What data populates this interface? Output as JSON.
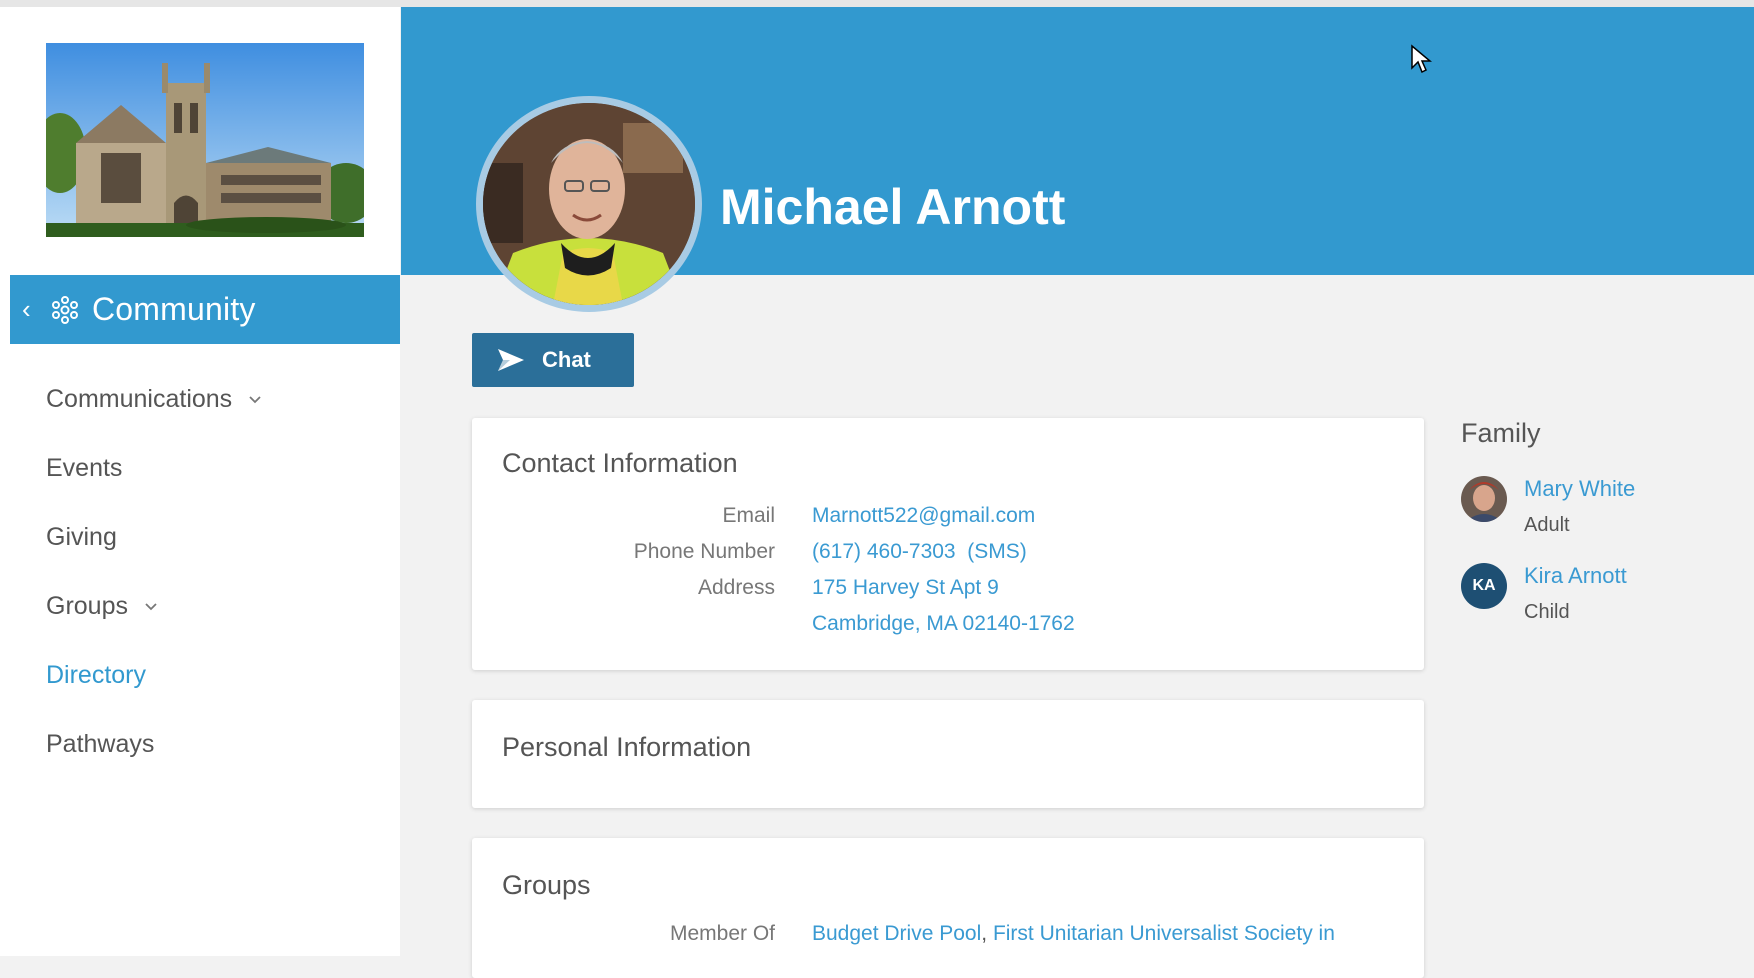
{
  "sidebar": {
    "section_title": "Community",
    "nav_items": [
      {
        "label": "Communications",
        "has_dropdown": true,
        "active": false
      },
      {
        "label": "Events",
        "has_dropdown": false,
        "active": false
      },
      {
        "label": "Giving",
        "has_dropdown": false,
        "active": false
      },
      {
        "label": "Groups",
        "has_dropdown": true,
        "active": false
      },
      {
        "label": "Directory",
        "has_dropdown": false,
        "active": true
      },
      {
        "label": "Pathways",
        "has_dropdown": false,
        "active": false
      }
    ]
  },
  "profile": {
    "name": "Michael Arnott",
    "chat_label": "Chat"
  },
  "contact": {
    "title": "Contact Information",
    "email_label": "Email",
    "email": "Marnott522@gmail.com",
    "phone_label": "Phone Number",
    "phone": "(617) 460-7303  (SMS)",
    "address_label": "Address",
    "address_line1": "175 Harvey St Apt 9",
    "address_line2": "Cambridge, MA 02140-1762"
  },
  "personal": {
    "title": "Personal Information"
  },
  "groups": {
    "title": "Groups",
    "member_of_label": "Member Of",
    "items": [
      "Budget Drive Pool",
      "First Unitarian Universalist Society in"
    ]
  },
  "family": {
    "title": "Family",
    "members": [
      {
        "name": "Mary White",
        "role": "Adult",
        "initials": ""
      },
      {
        "name": "Kira Arnott",
        "role": "Child",
        "initials": "KA"
      }
    ]
  },
  "colors": {
    "accent": "#3299cf",
    "button": "#2b6f99",
    "link": "#3a9ad2",
    "initials_badge": "#1e4f73"
  }
}
